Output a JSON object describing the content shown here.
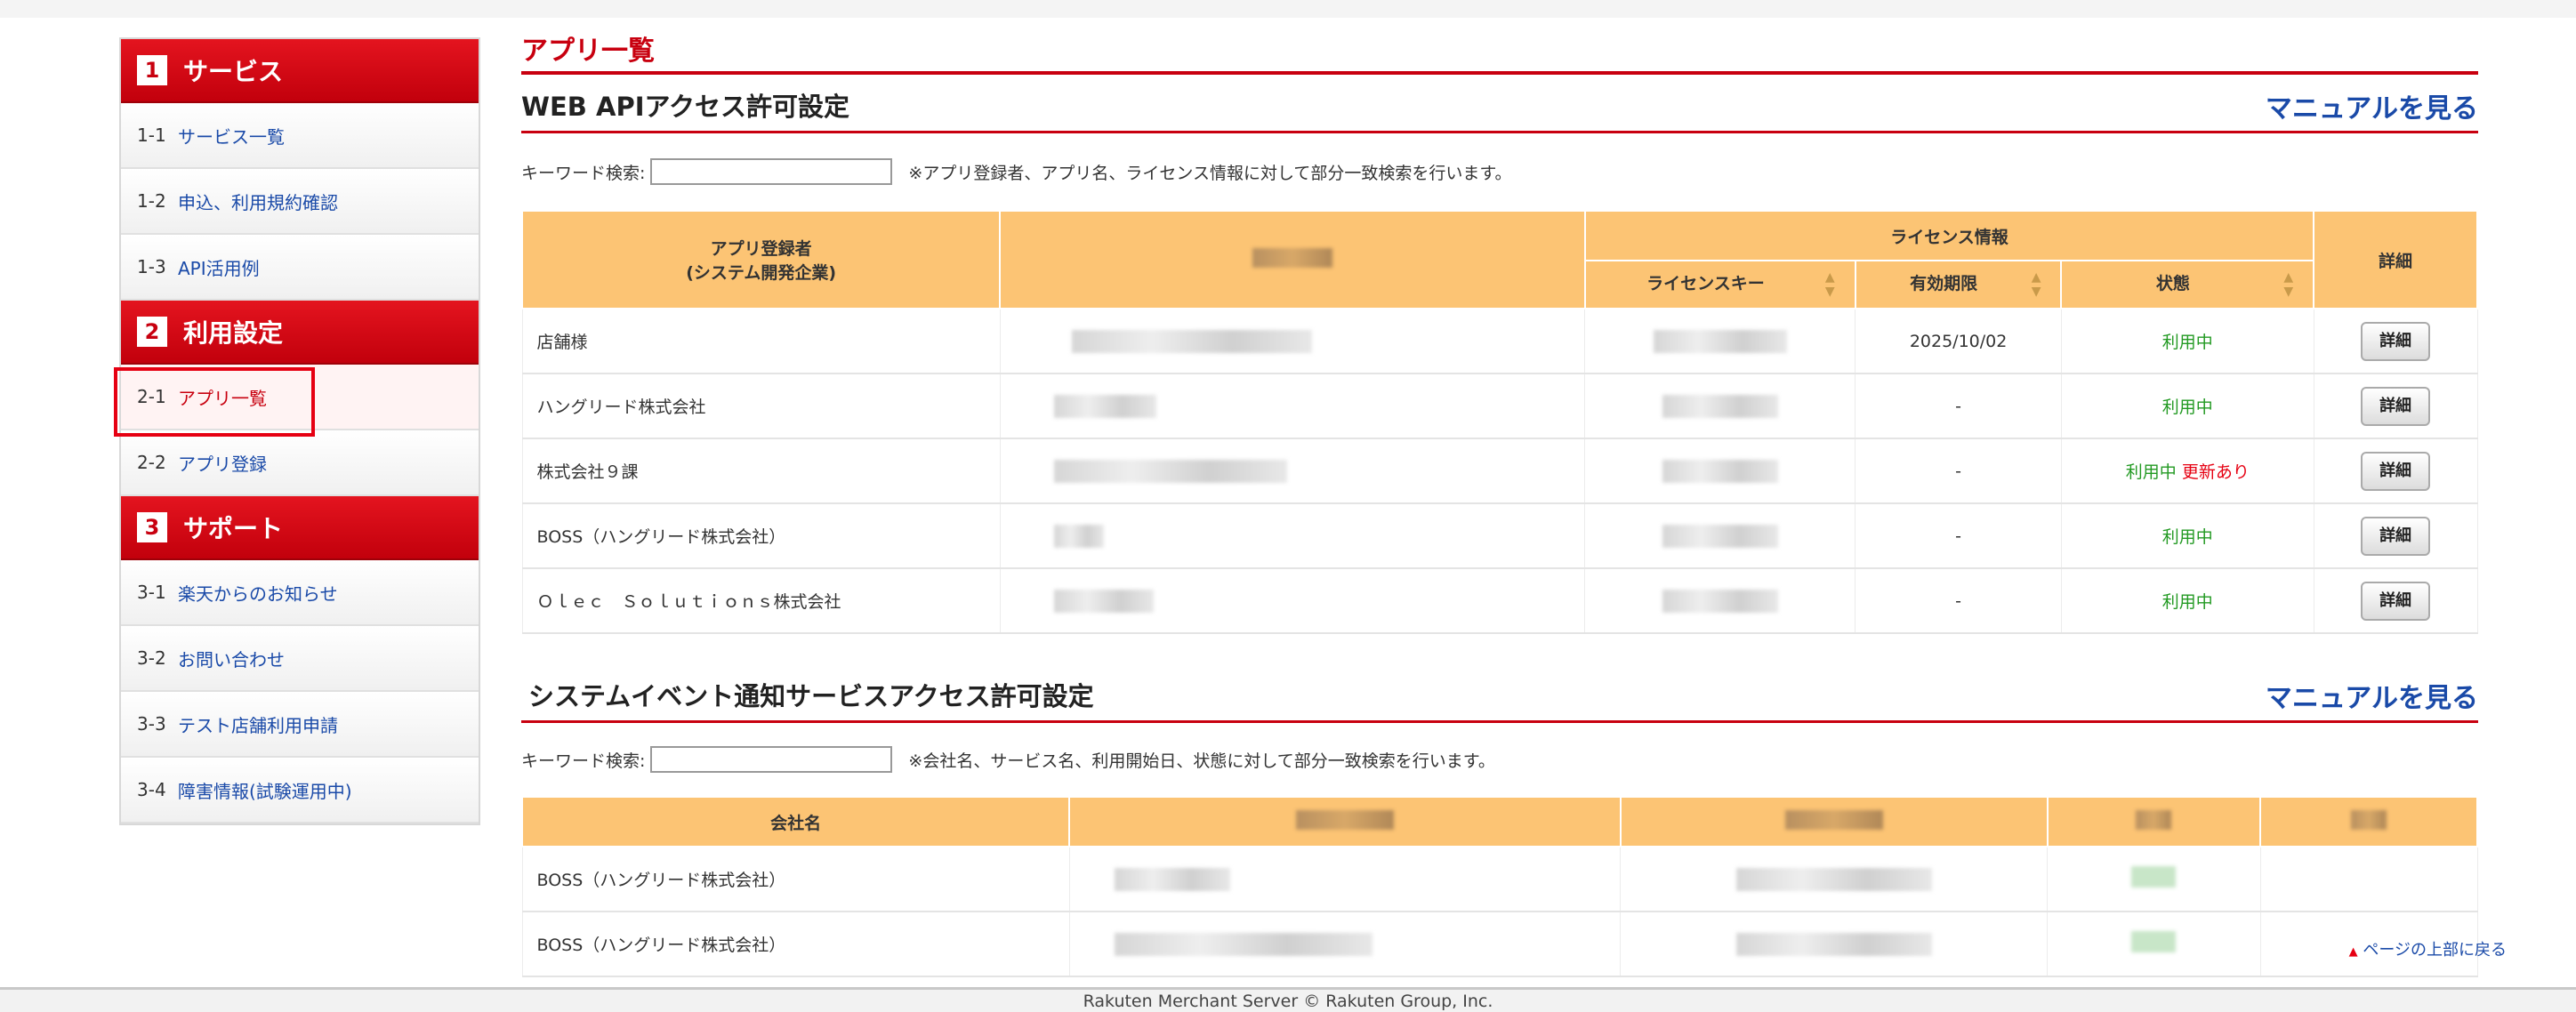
{
  "sidebar": {
    "sections": [
      {
        "num": "1",
        "title": "サービス",
        "items": [
          {
            "num": "1-1",
            "label": "サービス一覧"
          },
          {
            "num": "1-2",
            "label": "申込、利用規約確認"
          },
          {
            "num": "1-3",
            "label": "API活用例"
          }
        ]
      },
      {
        "num": "2",
        "title": "利用設定",
        "items": [
          {
            "num": "2-1",
            "label": "アプリ一覧"
          },
          {
            "num": "2-2",
            "label": "アプリ登録"
          }
        ]
      },
      {
        "num": "3",
        "title": "サポート",
        "items": [
          {
            "num": "3-1",
            "label": "楽天からのお知らせ"
          },
          {
            "num": "3-2",
            "label": "お問い合わせ"
          },
          {
            "num": "3-3",
            "label": "テスト店舗利用申請"
          },
          {
            "num": "3-4",
            "label": "障害情報(試験運用中)"
          }
        ]
      }
    ]
  },
  "main": {
    "page_title": "アプリ一覧",
    "webapi": {
      "title": "WEB APIアクセス許可設定",
      "manual": "マニュアルを見る",
      "search_label": "キーワード検索:",
      "search_note": "※アプリ登録者、アプリ名、ライセンス情報に対して部分一致検索を行います。",
      "col_registrant_1": "アプリ登録者",
      "col_registrant_2": "(システム開発企業)",
      "col_license_group": "ライセンス情報",
      "col_license_key": "ライセンスキー",
      "col_expiry": "有効期限",
      "col_status": "状態",
      "col_detail": "詳細",
      "detail_button": "詳細",
      "rows": [
        {
          "registrant": "店舗様",
          "expiry": "2025/10/02",
          "status": "利用中",
          "extra": ""
        },
        {
          "registrant": "ハングリード株式会社",
          "expiry": "-",
          "status": "利用中",
          "extra": ""
        },
        {
          "registrant": "株式会社９課",
          "expiry": "-",
          "status": "利用中",
          "extra": "更新あり"
        },
        {
          "registrant": "BOSS（ハングリード株式会社）",
          "expiry": "-",
          "status": "利用中",
          "extra": ""
        },
        {
          "registrant": "Ｏｌｅｃ　Ｓｏｌｕｔｉｏｎｓ株式会社",
          "expiry": "-",
          "status": "利用中",
          "extra": ""
        }
      ]
    },
    "sysevent": {
      "title": "システムイベント通知サービスアクセス許可設定",
      "manual": "マニュアルを見る",
      "search_label": "キーワード検索:",
      "search_note": "※会社名、サービス名、利用開始日、状態に対して部分一致検索を行います。",
      "col_company": "会社名",
      "rows": [
        {
          "company": "BOSS（ハングリード株式会社）"
        },
        {
          "company": "BOSS（ハングリード株式会社）"
        }
      ]
    },
    "back_to_top": "ページの上部に戻る"
  },
  "footer": {
    "text": "Rakuten Merchant Server © Rakuten Group, Inc."
  }
}
